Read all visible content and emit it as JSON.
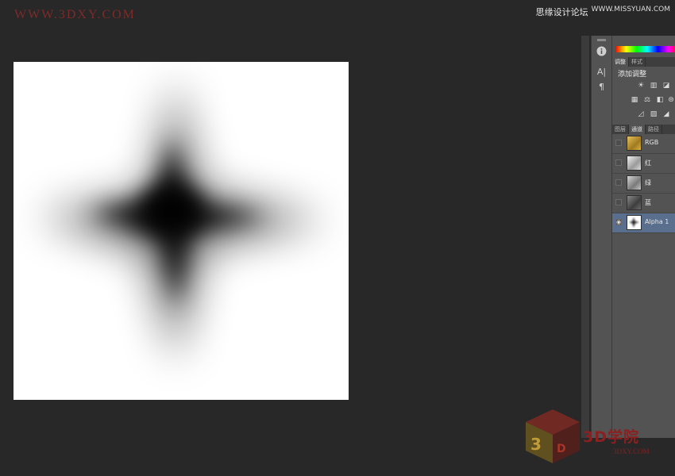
{
  "watermark": {
    "top_left": "WWW.3DXY.COM",
    "top_right_cn": "思缘设计论坛",
    "top_right_url": "WWW.MISSYUAN.COM",
    "bottom_cn": "3D学院",
    "bottom_url": "3DXY.COM"
  },
  "colors": {
    "background": "#282828",
    "panel": "#535353",
    "selected_row": "#5a6f8e",
    "canvas": "#ffffff"
  },
  "toolbar": {
    "icons": [
      "info-icon",
      "character-icon",
      "paragraph-icon"
    ],
    "info_glyph": "i",
    "char_glyph": "A|",
    "para_glyph": "¶"
  },
  "panel": {
    "tabs_top": [
      "调整",
      "样式"
    ],
    "adjust_label": "添加调整",
    "adjust_icons_row1": [
      "☀",
      "▥",
      "◪"
    ],
    "adjust_icons_row2": [
      "▦",
      "⚖",
      "◧",
      "⊜"
    ],
    "adjust_icons_row3": [
      "◿",
      "▨",
      "◢"
    ],
    "tabs_bottom": [
      "图层",
      "通道",
      "路径"
    ],
    "channels": [
      {
        "name": "RGB",
        "visible": false,
        "selected": false
      },
      {
        "name": "红",
        "visible": false,
        "selected": false
      },
      {
        "name": "绿",
        "visible": false,
        "selected": false
      },
      {
        "name": "蓝",
        "visible": false,
        "selected": false
      },
      {
        "name": "Alpha 1",
        "visible": true,
        "selected": true
      }
    ],
    "eye_glyph": "◉"
  }
}
